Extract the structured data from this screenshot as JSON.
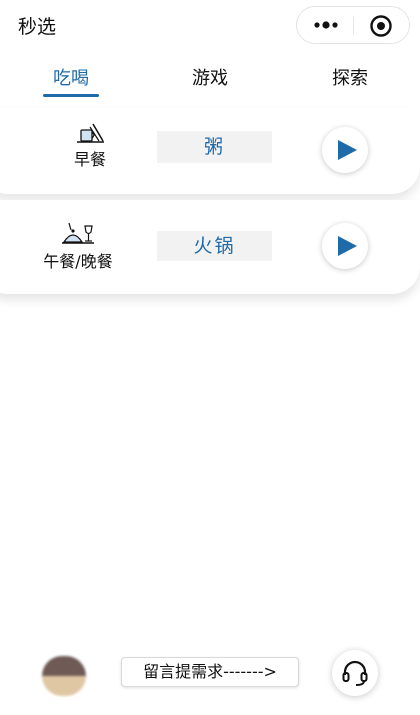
{
  "app": {
    "title": "秒选"
  },
  "capsule": {
    "more_icon": "more-dots-icon",
    "close_icon": "target-close-icon"
  },
  "tabs": [
    {
      "label": "吃喝",
      "active": true
    },
    {
      "label": "游戏",
      "active": false
    },
    {
      "label": "探索",
      "active": false
    }
  ],
  "meals": [
    {
      "label": "早餐",
      "icon": "breakfast-icon",
      "food": "粥",
      "action_icon": "play-icon"
    },
    {
      "label": "午餐/晚餐",
      "icon": "lunch-dinner-icon",
      "food": "火锅",
      "action_icon": "play-icon"
    }
  ],
  "footer": {
    "feedback_label": "留言提需求------->",
    "support_icon": "headset-icon"
  },
  "colors": {
    "accent": "#1f6aa8",
    "tag_bg": "#f2f2f2"
  }
}
